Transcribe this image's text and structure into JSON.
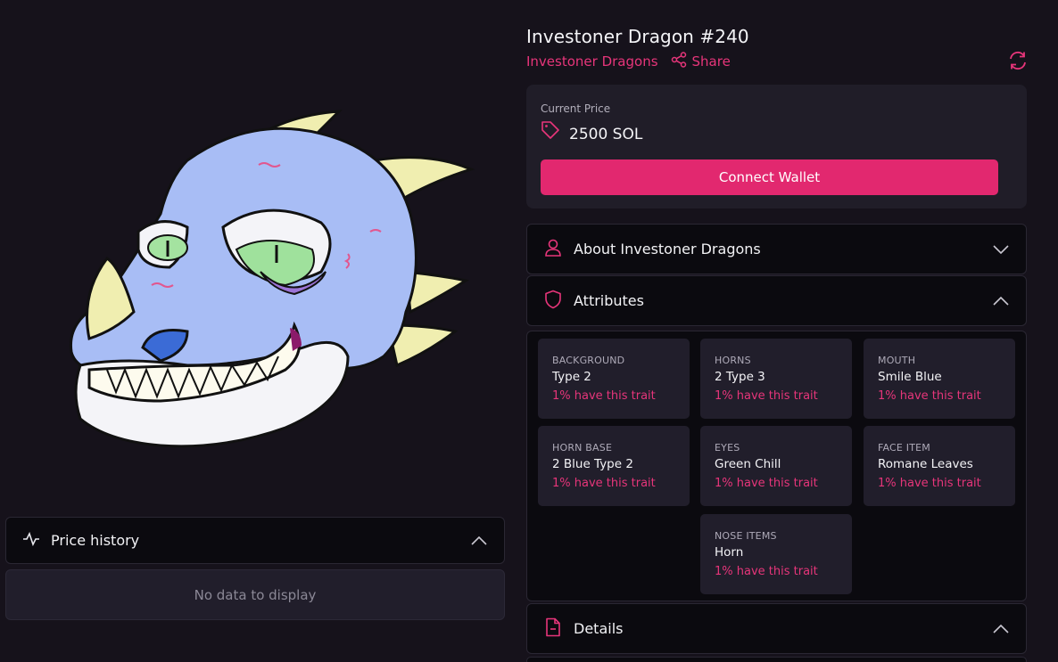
{
  "nft": {
    "title": "Investoner Dragon #240",
    "collection": "Investoner Dragons",
    "share_label": "Share"
  },
  "price": {
    "label": "Current Price",
    "value": "2500 SOL",
    "connect_label": "Connect Wallet"
  },
  "panels": {
    "about": "About Investoner Dragons",
    "attributes": "Attributes",
    "details": "Details",
    "price_history": "Price history",
    "no_data": "No data to display"
  },
  "attributes": [
    {
      "type": "BACKGROUND",
      "value": "Type 2",
      "rarity": "1% have this trait"
    },
    {
      "type": "HORNS",
      "value": "2 Type 3",
      "rarity": "1% have this trait"
    },
    {
      "type": "MOUTH",
      "value": "Smile Blue",
      "rarity": "1% have this trait"
    },
    {
      "type": "HORN BASE",
      "value": "2 Blue Type 2",
      "rarity": "1% have this trait"
    },
    {
      "type": "EYES",
      "value": "Green Chill",
      "rarity": "1% have this trait"
    },
    {
      "type": "FACE ITEM",
      "value": "Romane Leaves",
      "rarity": "1% have this trait"
    },
    {
      "type": "NOSE ITEMS",
      "value": "Horn",
      "rarity": "1% have this trait"
    }
  ],
  "icons": {
    "price_tag": "tag-icon",
    "share": "share-icon",
    "refresh": "refresh-icon",
    "about": "user-icon",
    "attributes": "shield-icon",
    "details": "file-icon",
    "price_history": "activity-icon"
  },
  "colors": {
    "accent": "#e2286f",
    "background": "#16121b",
    "card": "#211e2b"
  }
}
